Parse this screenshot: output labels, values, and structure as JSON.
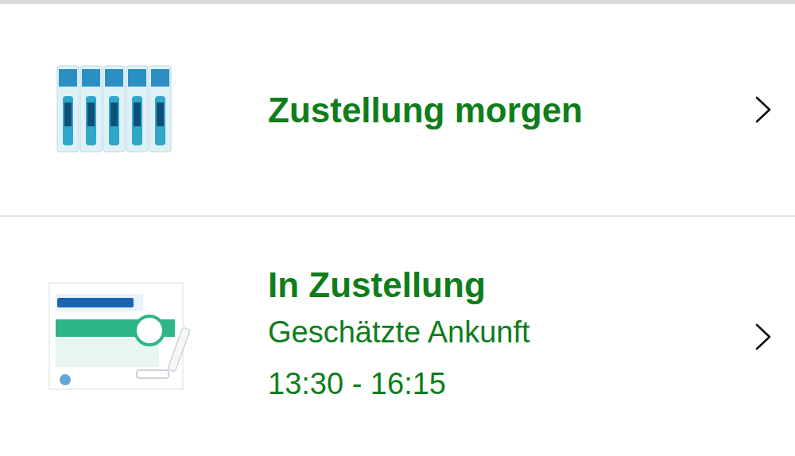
{
  "deliveries": [
    {
      "kind": "spray",
      "status": "Zustellung morgen",
      "details": []
    },
    {
      "kind": "box",
      "status": "In Zustellung",
      "details": [
        "Geschätzte Ankunft",
        "13:30 - 16:15"
      ]
    }
  ]
}
